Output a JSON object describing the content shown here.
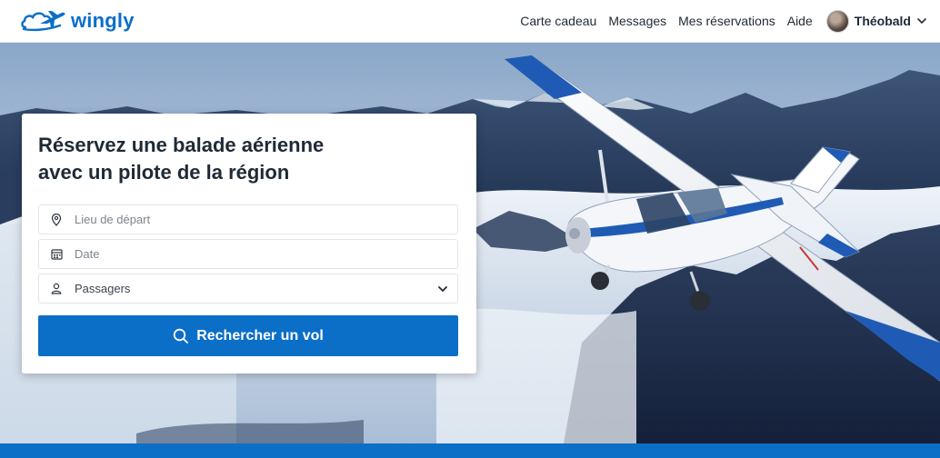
{
  "brand": {
    "name": "wingly",
    "color": "#0b6fc8"
  },
  "nav": {
    "items": [
      {
        "label": "Carte cadeau"
      },
      {
        "label": "Messages"
      },
      {
        "label": "Mes réservations"
      },
      {
        "label": "Aide"
      }
    ],
    "user": {
      "name": "Théobald",
      "icon": "chevron-down-icon"
    }
  },
  "search": {
    "title_line1": "Réservez une balade aérienne",
    "title_line2": "avec un pilote de la région",
    "departure": {
      "placeholder": "Lieu de départ",
      "value": "",
      "icon": "location-pin-icon"
    },
    "date": {
      "placeholder": "Date",
      "value": "",
      "icon": "calendar-icon"
    },
    "passengers": {
      "label": "Passagers",
      "icon": "person-icon"
    },
    "button_label": "Rechercher un vol",
    "button_icon": "search-icon"
  },
  "colors": {
    "primary": "#0b6fc8",
    "text": "#1f2a36",
    "border": "#e2e5e9"
  }
}
